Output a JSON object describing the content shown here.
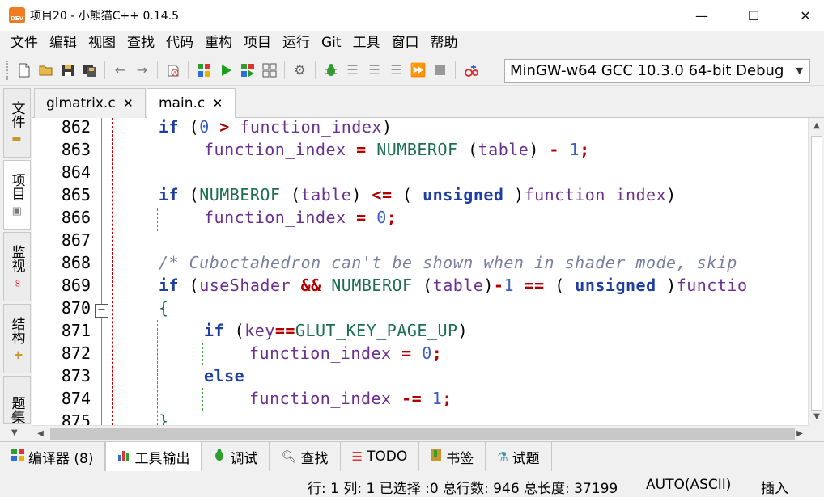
{
  "window": {
    "title": "项目20 - 小熊猫C++ 0.14.5",
    "icon_label": "DEV",
    "minimize_glyph": "—",
    "maximize_glyph": "☐",
    "close_glyph": "✕"
  },
  "menu": [
    "文件",
    "编辑",
    "视图",
    "查找",
    "代码",
    "重构",
    "项目",
    "运行",
    "Git",
    "工具",
    "窗口",
    "帮助"
  ],
  "toolbar": {
    "icons": [
      "new-file-icon",
      "open-file-icon",
      "save-icon",
      "save-all-icon",
      "back-arrow-icon",
      "forward-arrow-icon",
      "format-icon",
      "compile-icon",
      "run-icon",
      "compile-run-icon",
      "rebuild-icon",
      "options-icon",
      "debug-icon",
      "step-over-icon",
      "step-into-icon",
      "step-out-icon",
      "continue-icon",
      "stop-icon",
      "add-watch-icon"
    ],
    "compiler_value": "MinGW-w64 GCC 10.3.0 64-bit Debug"
  },
  "left_tabs": [
    {
      "label": "文件",
      "icon": "folder-icon"
    },
    {
      "label": "项目",
      "icon": "project-icon"
    },
    {
      "label": "监视",
      "icon": "watch-icon"
    },
    {
      "label": "结构",
      "icon": "structure-icon"
    },
    {
      "label": "题集",
      "icon": "problem-set-icon"
    }
  ],
  "editor_tabs": [
    {
      "label": "glmatrix.c",
      "close": "✕"
    },
    {
      "label": "main.c",
      "close": "✕"
    }
  ],
  "line_numbers": [
    "862",
    "863",
    "864",
    "865",
    "866",
    "867",
    "868",
    "869",
    "870",
    "871",
    "872",
    "873",
    "874",
    "875"
  ],
  "code": {
    "l862": {
      "kw": "if",
      "p1": " (",
      "n1": "0",
      "op": " > ",
      "id": "function_index",
      "p2": ")"
    },
    "l863": {
      "id": "function_index",
      "op1": " = ",
      "mac": "NUMBEROF",
      "p1": " (",
      "id2": "table",
      "p2": ")",
      "op2": " - ",
      "n": "1",
      "semi": ";"
    },
    "l865": {
      "kw": "if",
      "p1": " (",
      "mac": "NUMBEROF",
      "p2": " (",
      "id": "table",
      "p3": ")",
      "op": " <= ",
      "p4": "( ",
      "kw2": "unsigned",
      "p5": " )",
      "id2": "function_index",
      "p6": ")"
    },
    "l866": {
      "id": "function_index",
      "op": " = ",
      "n": "0",
      "semi": ";"
    },
    "l868": {
      "comment": "/* Cuboctahedron can't be shown when in shader mode, skip"
    },
    "l869": {
      "kw": "if",
      "p1": " (",
      "id": "useShader",
      "op1": " && ",
      "mac": "NUMBEROF",
      "p2": " (",
      "id2": "table",
      "p3": ")",
      "op2": "-",
      "n": "1",
      "op3": " == ",
      "p4": "( ",
      "kw2": "unsigned",
      "p5": " )",
      "id3": "functio"
    },
    "l870": {
      "brace": "{"
    },
    "l871": {
      "kw": "if",
      "p1": " (",
      "id": "key",
      "op": "==",
      "mac": "GLUT_KEY_PAGE_UP",
      "p2": ")"
    },
    "l872": {
      "id": "function_index",
      "op": " = ",
      "n": "0",
      "semi": ";"
    },
    "l873": {
      "kw": "else"
    },
    "l874": {
      "id": "function_index",
      "op": " -= ",
      "n": "1",
      "semi": ";"
    },
    "l875": {
      "brace": "}"
    }
  },
  "bottom_tabs": [
    {
      "label": "编译器 (8)",
      "icon": "compiler-icon"
    },
    {
      "label": "工具输出",
      "icon": "tool-output-icon"
    },
    {
      "label": "调试",
      "icon": "debug-bug-icon"
    },
    {
      "label": "查找",
      "icon": "search-icon"
    },
    {
      "label": "TODO",
      "icon": "todo-icon"
    },
    {
      "label": "书签",
      "icon": "bookmark-icon"
    },
    {
      "label": "试题",
      "icon": "flask-icon"
    }
  ],
  "status": {
    "position": "行: 1 列: 1 已选择 :0 总行数: 946 总长度: 37199",
    "encoding": "AUTO(ASCII)",
    "mode": "插入"
  },
  "colors": {
    "keyword": "#1f3ea1",
    "identifier": "#6a2f8f",
    "macro": "#1d6e52",
    "number": "#3a5dc8",
    "operator": "#b00000",
    "comment": "#7a7fa0"
  }
}
